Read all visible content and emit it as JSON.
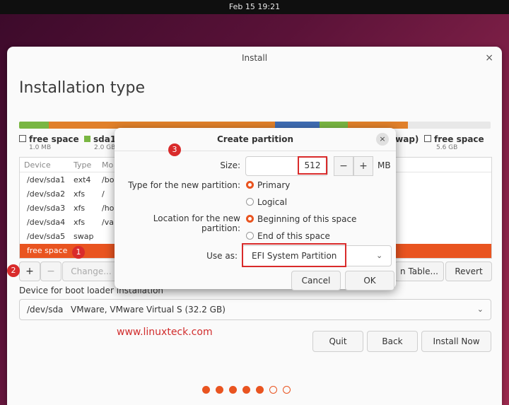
{
  "topbar": {
    "datetime": "Feb 15  19:21"
  },
  "window": {
    "title": "Install",
    "close": "×",
    "heading": "Installation type"
  },
  "partition_bar_colors": [
    "#79b642",
    "#e0802a",
    "#e0802a",
    "#3f6db3",
    "#79b642",
    "#e0802a",
    "#e8e8e8"
  ],
  "legend": {
    "free_left": {
      "label": "free space",
      "size": "1.0 MB"
    },
    "sda1": {
      "label": "sda1",
      "size": "2.0 GB",
      "color": "#79b642"
    },
    "swap": {
      "label": "swap)"
    },
    "free_right": {
      "label": "free space",
      "size": "5.6 GB"
    }
  },
  "table": {
    "headers": [
      "Device",
      "Type",
      "Mo"
    ],
    "rows": [
      {
        "device": "/dev/sda1",
        "type": "ext4",
        "mount": "/bo"
      },
      {
        "device": "/dev/sda2",
        "type": "xfs",
        "mount": "/"
      },
      {
        "device": "/dev/sda3",
        "type": "xfs",
        "mount": "/ho"
      },
      {
        "device": "/dev/sda4",
        "type": "xfs",
        "mount": "/va"
      },
      {
        "device": "/dev/sda5",
        "type": "swap",
        "mount": ""
      }
    ],
    "selected_row": "free space"
  },
  "table_buttons": {
    "add": "+",
    "remove": "−",
    "change": "Change...",
    "new_table": "n Table...",
    "revert": "Revert"
  },
  "boot": {
    "label": "Device for boot loader installation",
    "device": "/dev/sda",
    "description": "VMware, VMware Virtual S (32.2 GB)"
  },
  "watermark": "www.linuxteck.com",
  "footer_buttons": {
    "quit": "Quit",
    "back": "Back",
    "install": "Install Now"
  },
  "dots": {
    "filled": 5,
    "total": 7
  },
  "markers": {
    "one": "1",
    "two": "2",
    "three": "3"
  },
  "dialog": {
    "title": "Create partition",
    "close": "×",
    "size_label": "Size:",
    "size_value": "512",
    "minus": "−",
    "plus": "+",
    "unit": "MB",
    "type_label": "Type for the new partition:",
    "type_options": [
      "Primary",
      "Logical"
    ],
    "location_label": "Location for the new partition:",
    "location_options": [
      "Beginning of this space",
      "End of this space"
    ],
    "use_as_label": "Use as:",
    "use_as_value": "EFI System Partition",
    "cancel": "Cancel",
    "ok": "OK"
  },
  "accent_color": "#e95420",
  "highlight_color": "#d92b2b"
}
